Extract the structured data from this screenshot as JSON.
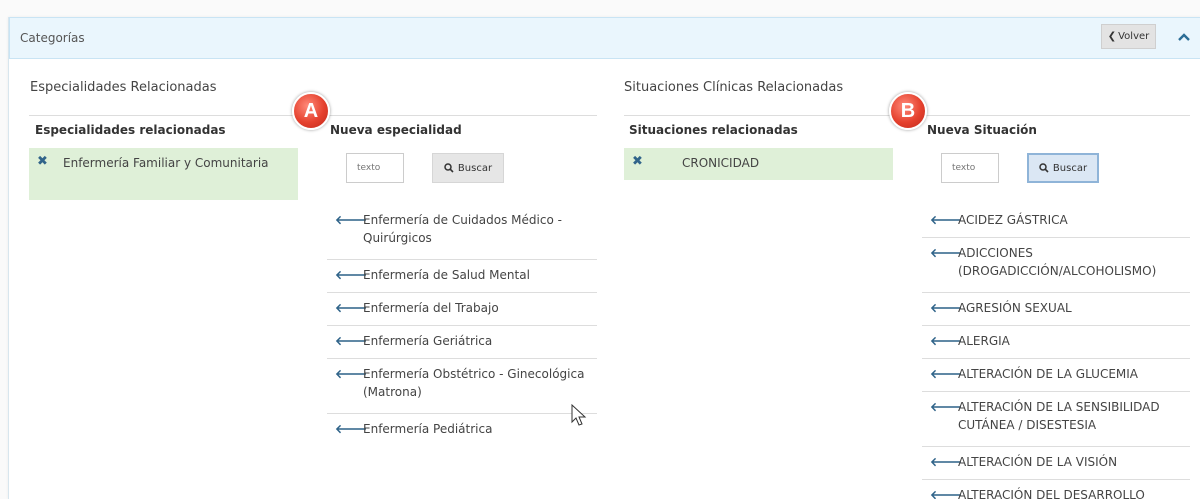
{
  "panel": {
    "title": "Categorías",
    "back_label": "Volver"
  },
  "specialties": {
    "section_title": "Especialidades Relacionadas",
    "related_header": "Especialidades relacionadas",
    "related": [
      "Enfermería Familiar y Comunitaria"
    ],
    "new_header": "Nueva especialidad",
    "search_placeholder": "texto",
    "search_label": "Buscar",
    "badge": "A",
    "items": [
      "Enfermería de Cuidados Médico - Quirúrgicos",
      "Enfermería de Salud Mental",
      "Enfermería del Trabajo",
      "Enfermería Geriátrica",
      "Enfermería Obstétrico - Ginecológica (Matrona)",
      "Enfermería Pediátrica"
    ]
  },
  "situations": {
    "section_title": "Situaciones Clínicas Relacionadas",
    "related_header": "Situaciones relacionadas",
    "related": [
      "CRONICIDAD"
    ],
    "new_header": "Nueva Situación",
    "search_placeholder": "texto",
    "search_label": "Buscar",
    "badge": "B",
    "items": [
      "ACIDEZ GÁSTRICA",
      "ADICCIONES (DROGADICCIÓN/ALCOHOLISMO)",
      "AGRESIÓN SEXUAL",
      "ALERGIA",
      "ALTERACIÓN DE LA GLUCEMIA",
      "ALTERACIÓN DE LA SENSIBILIDAD CUTÁNEA / DISESTESIA",
      "ALTERACIÓN DE LA VISIÓN",
      "ALTERACIÓN DEL DESARROLLO"
    ]
  },
  "colors": {
    "accent": "#2f6389",
    "related_bg": "#dff0d8",
    "header_bg": "#eaf6fd",
    "badge": "#e5412e"
  }
}
